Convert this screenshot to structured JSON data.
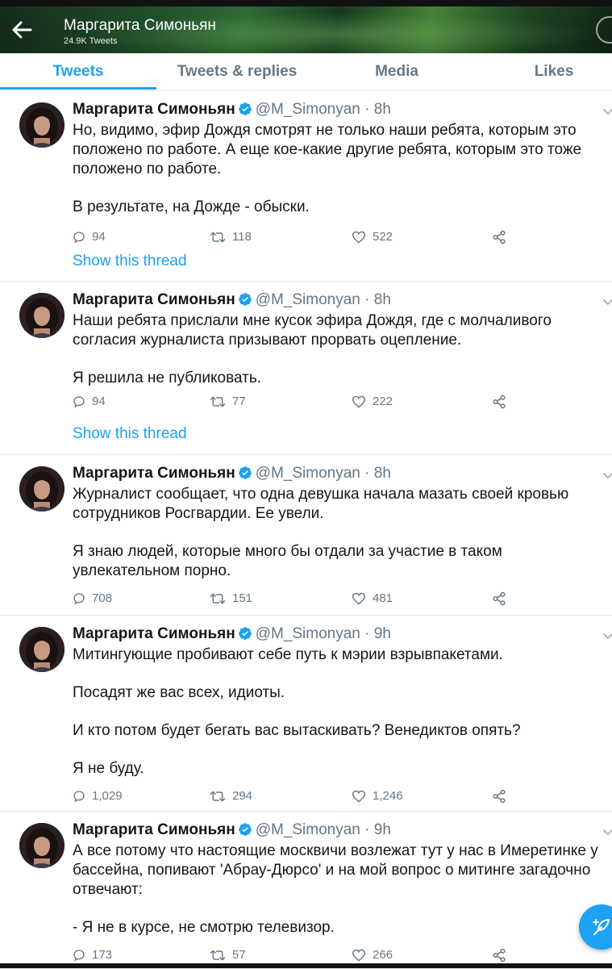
{
  "header": {
    "title": "Маргарита Симоньян",
    "subtitle": "24.9K Tweets"
  },
  "tabs": [
    {
      "label": "Tweets",
      "active": true
    },
    {
      "label": "Tweets & replies",
      "active": false
    },
    {
      "label": "Media",
      "active": false
    },
    {
      "label": "Likes",
      "active": false
    }
  ],
  "colors": {
    "accent": "#1da1f2",
    "muted": "#657786",
    "text": "#14171a"
  },
  "tweets": [
    {
      "author": "Маргарита Симоньян",
      "handle": "@M_Simonyan",
      "sep": "·",
      "time": "8h",
      "paragraphs": [
        "Но, видимо, эфир Дождя смотрят не только наши ребята, которым это положено по работе. А еще кое-какие другие ребята, которым это тоже положено по работе.",
        "В результате, на Дожде - обыски."
      ],
      "replies": "94",
      "retweets": "118",
      "likes": "522",
      "thread_link": "Show this thread"
    },
    {
      "author": "Маргарита Симоньян",
      "handle": "@M_Simonyan",
      "sep": "·",
      "time": "8h",
      "paragraphs": [
        "Наши ребята прислали мне кусок эфира Дождя, где с молчаливого согласия журналиста призывают прорвать оцепление.",
        "Я решила не публиковать."
      ],
      "replies": "94",
      "retweets": "77",
      "likes": "222",
      "thread_link": "Show this thread"
    },
    {
      "author": "Маргарита Симоньян",
      "handle": "@M_Simonyan",
      "sep": "·",
      "time": "8h",
      "paragraphs": [
        "Журналист сообщает, что одна девушка начала мазать своей кровью сотрудников Росгвардии. Ее увели.",
        "Я знаю людей, которые много бы отдали за участие в таком увлекательном порно."
      ],
      "replies": "708",
      "retweets": "151",
      "likes": "481"
    },
    {
      "author": "Маргарита Симоньян",
      "handle": "@M_Simonyan",
      "sep": "·",
      "time": "9h",
      "paragraphs": [
        "Митингующие пробивают себе путь к мэрии взрывпакетами.",
        "Посадят же вас всех, идиоты.",
        "И кто потом будет бегать вас вытаскивать? Венедиктов опять?",
        "Я не буду."
      ],
      "replies": "1,029",
      "retweets": "294",
      "likes": "1,246"
    },
    {
      "author": "Маргарита Симоньян",
      "handle": "@M_Simonyan",
      "sep": "·",
      "time": "9h",
      "paragraphs": [
        "А все потому что настоящие москвичи возлежат тут у нас в Имеретинке у бассейна, попивают 'Абрау-Дюрсо' и на мой вопрос о митинге загадочно отвечают:",
        "- Я не в курсе, не смотрю телевизор."
      ],
      "replies": "173",
      "retweets": "57",
      "likes": "266"
    }
  ]
}
